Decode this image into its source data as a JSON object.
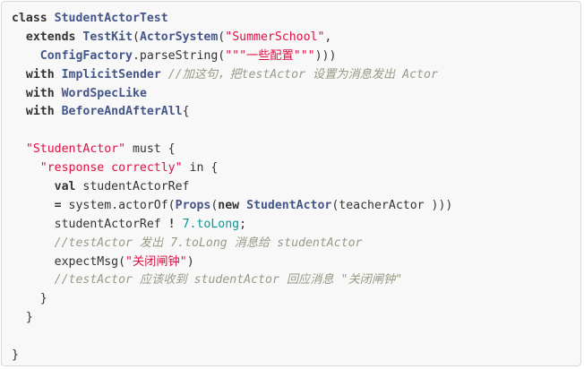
{
  "code_lines": [
    [
      {
        "t": "kw",
        "s": "class"
      },
      {
        "t": "plain",
        "s": " "
      },
      {
        "t": "type",
        "s": "StudentActorTest"
      }
    ],
    [
      {
        "t": "plain",
        "s": "  "
      },
      {
        "t": "kw",
        "s": "extends"
      },
      {
        "t": "plain",
        "s": " "
      },
      {
        "t": "type",
        "s": "TestKit"
      },
      {
        "t": "plain",
        "s": "("
      },
      {
        "t": "type",
        "s": "ActorSystem"
      },
      {
        "t": "plain",
        "s": "("
      },
      {
        "t": "str",
        "s": "\"SummerSchool\""
      },
      {
        "t": "plain",
        "s": ","
      }
    ],
    [
      {
        "t": "plain",
        "s": "    "
      },
      {
        "t": "type",
        "s": "ConfigFactory"
      },
      {
        "t": "plain",
        "s": ".parseString("
      },
      {
        "t": "str",
        "s": "\"\"\"一些配置\"\"\""
      },
      {
        "t": "plain",
        "s": ")))"
      }
    ],
    [
      {
        "t": "plain",
        "s": "  "
      },
      {
        "t": "kw",
        "s": "with"
      },
      {
        "t": "plain",
        "s": " "
      },
      {
        "t": "type",
        "s": "ImplicitSender"
      },
      {
        "t": "plain",
        "s": " "
      },
      {
        "t": "com",
        "s": "//加这句，把testActor 设置为消息发出 Actor"
      }
    ],
    [
      {
        "t": "plain",
        "s": "  "
      },
      {
        "t": "kw",
        "s": "with"
      },
      {
        "t": "plain",
        "s": " "
      },
      {
        "t": "type",
        "s": "WordSpecLike"
      }
    ],
    [
      {
        "t": "plain",
        "s": "  "
      },
      {
        "t": "kw",
        "s": "with"
      },
      {
        "t": "plain",
        "s": " "
      },
      {
        "t": "type",
        "s": "BeforeAndAfterAll"
      },
      {
        "t": "plain",
        "s": "{"
      }
    ],
    [],
    [
      {
        "t": "plain",
        "s": "  "
      },
      {
        "t": "str",
        "s": "\"StudentActor\""
      },
      {
        "t": "plain",
        "s": " must {"
      }
    ],
    [
      {
        "t": "plain",
        "s": "    "
      },
      {
        "t": "str",
        "s": "\"response correctly\""
      },
      {
        "t": "plain",
        "s": " in {"
      }
    ],
    [
      {
        "t": "plain",
        "s": "      "
      },
      {
        "t": "kw",
        "s": "val"
      },
      {
        "t": "plain",
        "s": " studentActorRef"
      }
    ],
    [
      {
        "t": "plain",
        "s": "      "
      },
      {
        "t": "op",
        "s": "="
      },
      {
        "t": "plain",
        "s": " system.actorOf("
      },
      {
        "t": "type",
        "s": "Props"
      },
      {
        "t": "plain",
        "s": "("
      },
      {
        "t": "kw",
        "s": "new"
      },
      {
        "t": "plain",
        "s": " "
      },
      {
        "t": "type",
        "s": "StudentActor"
      },
      {
        "t": "plain",
        "s": "(teacherActor )))"
      }
    ],
    [
      {
        "t": "plain",
        "s": "      studentActorRef "
      },
      {
        "t": "op",
        "s": "!"
      },
      {
        "t": "plain",
        "s": " "
      },
      {
        "t": "num",
        "s": "7.toLong"
      },
      {
        "t": "plain",
        "s": ";"
      }
    ],
    [
      {
        "t": "plain",
        "s": "      "
      },
      {
        "t": "com",
        "s": "//testActor 发出 7.toLong 消息给 studentActor"
      }
    ],
    [
      {
        "t": "plain",
        "s": "      expectMsg("
      },
      {
        "t": "str",
        "s": "\"关闭闸钟\""
      },
      {
        "t": "plain",
        "s": ")"
      }
    ],
    [
      {
        "t": "plain",
        "s": "      "
      },
      {
        "t": "com",
        "s": "//testActor 应该收到 studentActor 回应消息 \"关闭闸钟\""
      }
    ],
    [
      {
        "t": "plain",
        "s": "    }"
      }
    ],
    [
      {
        "t": "plain",
        "s": "  }"
      }
    ],
    [],
    [
      {
        "t": "plain",
        "s": "}"
      }
    ]
  ]
}
